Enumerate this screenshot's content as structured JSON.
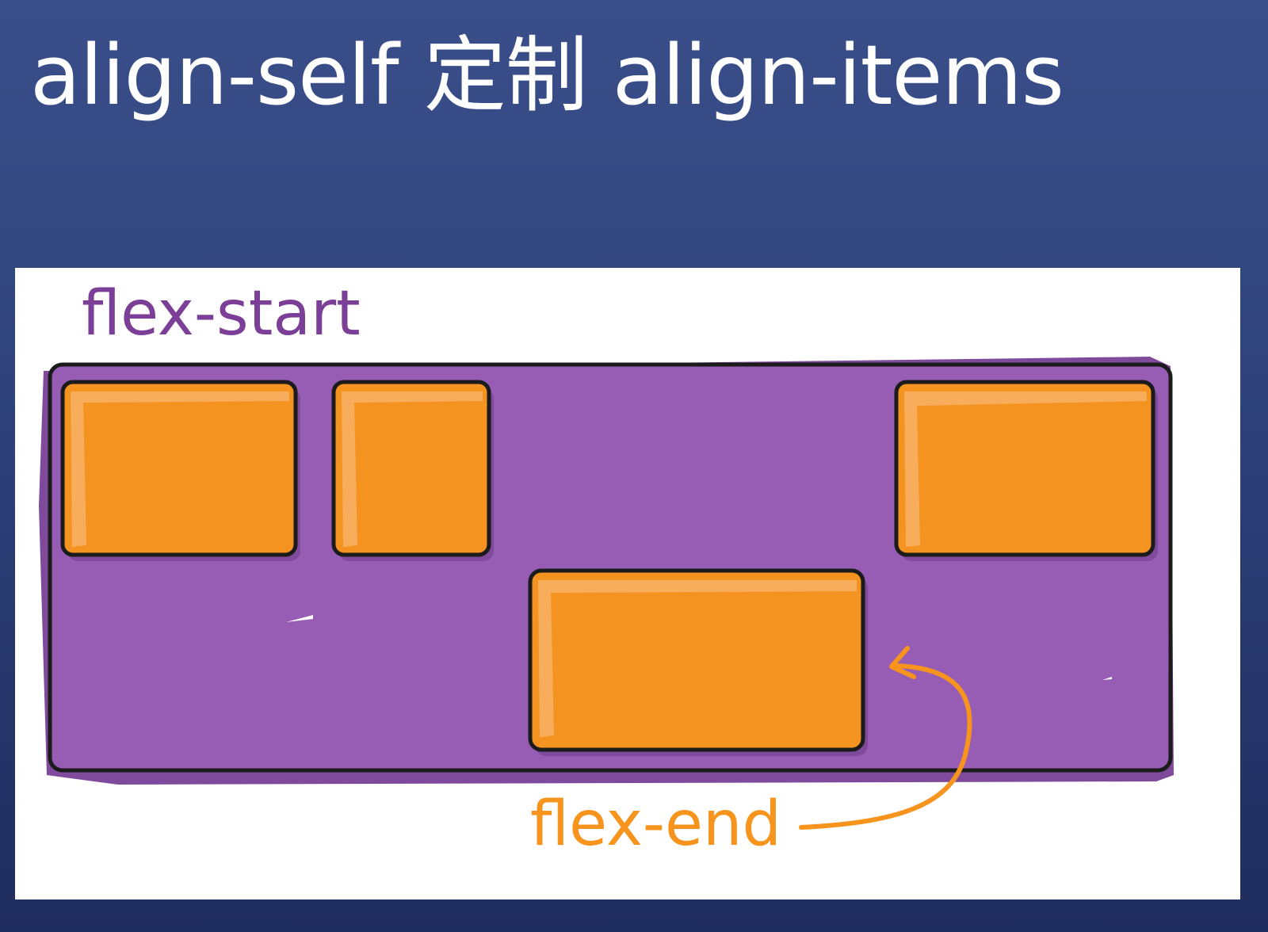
{
  "title": "align-self 定制 align-items",
  "diagram": {
    "start_label": "flex-start",
    "end_label": "flex-end"
  },
  "colors": {
    "background_top": "#3a4f8a",
    "background_bottom": "#1f2c5e",
    "panel": "#ffffff",
    "container_fill": "#975db5",
    "container_shadow": "#7f4a9c",
    "item_fill": "#f59321",
    "item_highlight": "#f8ad5c",
    "outline": "#1b1b1b",
    "start_label": "#7c3f98",
    "end_label": "#f7941d"
  }
}
